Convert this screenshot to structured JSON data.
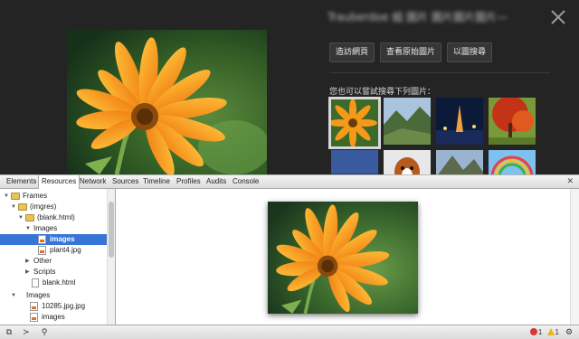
{
  "viewer": {
    "title_blurred": "Trauberdoe 組 圖片 圖片圖片圖片—",
    "buttons": [
      "造訪網頁",
      "查看原始圖片",
      "以圖搜尋"
    ],
    "similar_label": "您也可以嘗試搜尋下列圖片：",
    "close_icon": "close-icon",
    "thumbnails": [
      "flower",
      "mountain-valley",
      "fountain-night",
      "autumn-tree",
      "city-sky",
      "dog",
      "mountains",
      "rainbow"
    ]
  },
  "devtools": {
    "tabs": [
      "Elements",
      "Resources",
      "Network",
      "Sources",
      "Timeline",
      "Profiles",
      "Audits",
      "Console"
    ],
    "active_tab": "Resources",
    "tree": [
      {
        "label": "Frames",
        "indent": 0,
        "icon": "folder",
        "expanded": true
      },
      {
        "label": "(imgres)",
        "indent": 1,
        "icon": "folder",
        "expanded": true
      },
      {
        "label": "(blank.html)",
        "indent": 2,
        "icon": "folder",
        "expanded": true
      },
      {
        "label": "Images",
        "indent": 3,
        "icon": "none",
        "expanded": true
      },
      {
        "label": "images",
        "indent": 4,
        "icon": "img",
        "selected": true
      },
      {
        "label": "plant4.jpg",
        "indent": 4,
        "icon": "img"
      },
      {
        "label": "Other",
        "indent": 3,
        "icon": "none",
        "expanded": false
      },
      {
        "label": "Scripts",
        "indent": 3,
        "icon": "none",
        "expanded": false
      },
      {
        "label": "blank.html",
        "indent": 3,
        "icon": "file"
      },
      {
        "label": "Images",
        "indent": 1,
        "icon": "none",
        "expanded": true
      },
      {
        "label": "10285.jpg.jpg",
        "indent": 2,
        "icon": "img"
      },
      {
        "label": "images",
        "indent": 2,
        "icon": "img"
      }
    ],
    "status": {
      "errors": "1",
      "warnings": "1"
    }
  },
  "colors": {
    "selection": "#3875d7",
    "viewer_bg": "#242424",
    "petal": "#f19a1c"
  }
}
